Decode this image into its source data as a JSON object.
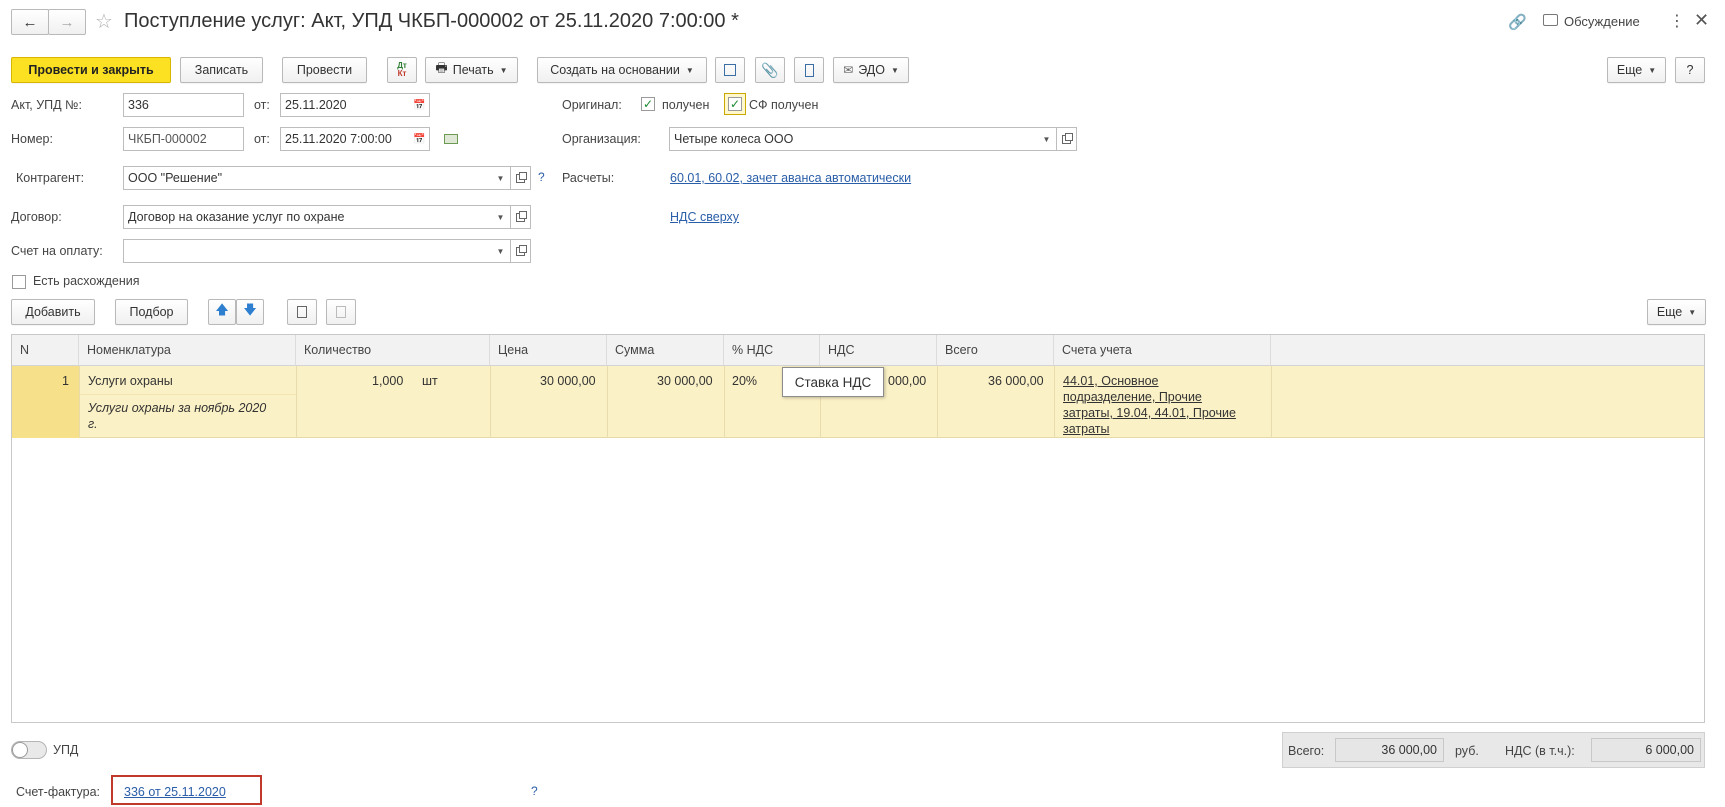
{
  "window": {
    "title": "Поступление услуг: Акт, УПД ЧКБП-000002 от 25.11.2020 7:00:00 *",
    "discussion_label": "Обсуждение"
  },
  "toolbar": {
    "post_close": "Провести и закрыть",
    "save": "Записать",
    "post": "Провести",
    "dtkt_top": "Дт",
    "dtkt_bottom": "Кт",
    "print": "Печать",
    "create_based": "Создать на основании",
    "edo": "ЭДО",
    "more": "Еще",
    "help": "?"
  },
  "header": {
    "act_label": "Акт, УПД №:",
    "act_value": "336",
    "from_label": "от:",
    "act_date": "25.11.2020",
    "number_label": "Номер:",
    "number_value": "ЧКБП-000002",
    "from_label2": "от:",
    "number_date": "25.11.2020  7:00:00",
    "original_label": "Оригинал:",
    "received_label": "получен",
    "sf_received_label": "СФ получен",
    "org_label": "Организация:",
    "org_value": "Четыре колеса ООО",
    "contractor_label": "Контрагент:",
    "contractor_value": "ООО \"Решение\"",
    "settlements_label": "Расчеты:",
    "settlements_link": "60.01, 60.02, зачет аванса автоматически",
    "contract_label": "Договор:",
    "contract_value": "Договор на оказание услуг по охране",
    "vat_link": "НДС сверху",
    "invoice_pay_label": "Счет на оплату:",
    "invoice_pay_value": "",
    "discrepancy_label": "Есть расхождения",
    "help_mark": "?"
  },
  "table_toolbar": {
    "add": "Добавить",
    "pick": "Подбор",
    "more": "Еще"
  },
  "table": {
    "columns": [
      "N",
      "Номенклатура",
      "Количество",
      "Цена",
      "Сумма",
      "% НДС",
      "НДС",
      "Всего",
      "Счета учета"
    ],
    "rows": [
      {
        "n": "1",
        "item": "Услуги охраны",
        "item_desc_1": "Услуги охраны за ноябрь 2020",
        "item_desc_2": "г.",
        "qty": "1,000",
        "unit": "шт",
        "price": "30 000,00",
        "sum": "30 000,00",
        "vat_rate": "20%",
        "vat": "000,00",
        "total": "36 000,00",
        "accounts_1": "44.01, Основное",
        "accounts_2": "подразделение, Прочие",
        "accounts_3": "затраты, 19.04, 44.01, Прочие",
        "accounts_4": "затраты"
      }
    ],
    "tooltip": "Ставка НДС"
  },
  "footer": {
    "upd_label": "УПД",
    "total_label": "Всего:",
    "total_value": "36 000,00",
    "currency": "руб.",
    "vat_label": "НДС (в т.ч.):",
    "vat_value": "6 000,00",
    "invoice_label": "Счет-фактура:",
    "invoice_link": "336 от 25.11.2020",
    "help_mark": "?"
  },
  "colors": {
    "primary_button": "#fbe122",
    "row_highlight": "#fbf1c6",
    "link": "#2a5ea8",
    "highlight_frame": "#c0392b"
  }
}
